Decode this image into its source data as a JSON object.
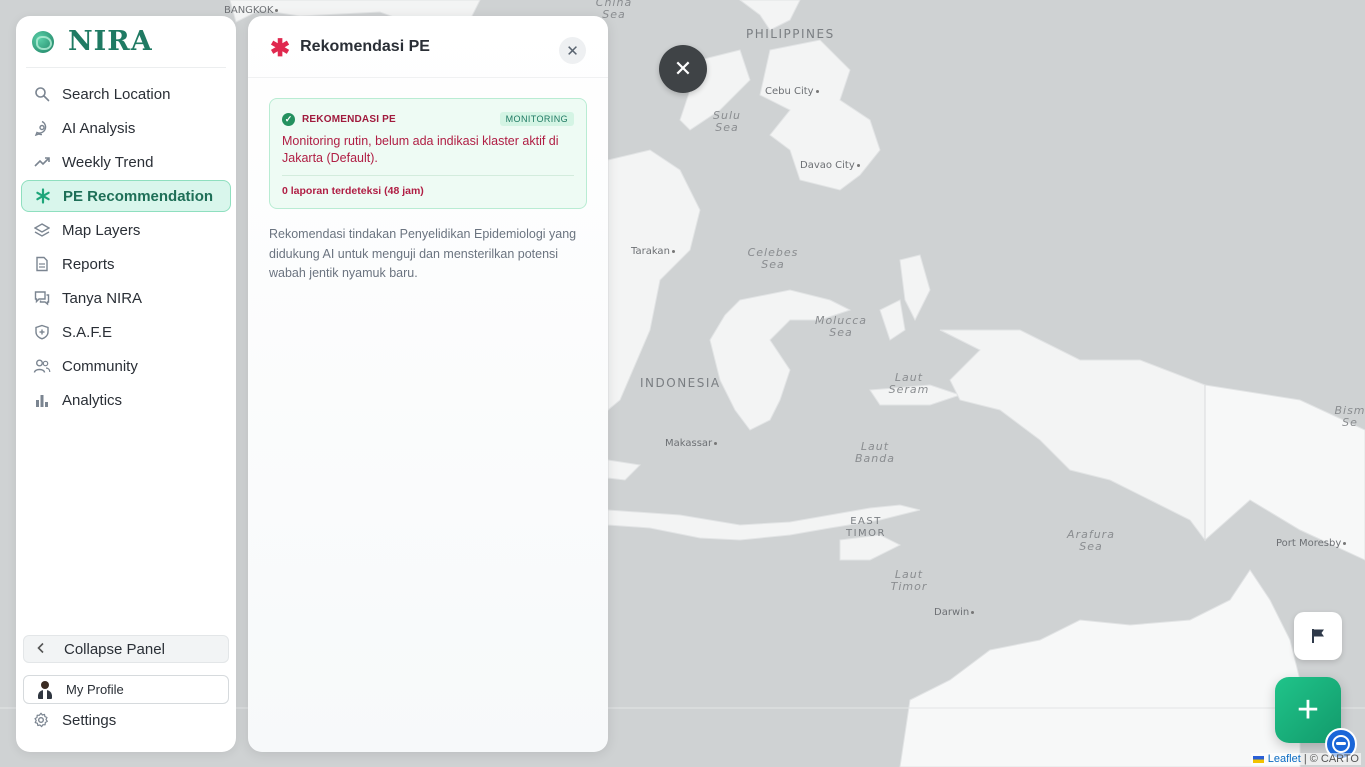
{
  "app": {
    "logo_text": "NIRA"
  },
  "sidebar": {
    "items": [
      {
        "label": "Search Location",
        "icon": "search-icon",
        "active": false
      },
      {
        "label": "AI Analysis",
        "icon": "ai-analysis-icon",
        "active": false
      },
      {
        "label": "Weekly Trend",
        "icon": "trend-icon",
        "active": false
      },
      {
        "label": "PE Recommendation",
        "icon": "asterisk-icon",
        "active": true
      },
      {
        "label": "Map Layers",
        "icon": "layers-icon",
        "active": false
      },
      {
        "label": "Reports",
        "icon": "report-icon",
        "active": false
      },
      {
        "label": "Tanya NIRA",
        "icon": "chat-icon",
        "active": false
      },
      {
        "label": "S.A.F.E",
        "icon": "shield-icon",
        "active": false
      },
      {
        "label": "Community",
        "icon": "community-icon",
        "active": false
      },
      {
        "label": "Analytics",
        "icon": "bar-chart-icon",
        "active": false
      }
    ],
    "collapse_label": "Collapse Panel",
    "profile_label": "My Profile",
    "settings_label": "Settings"
  },
  "panel": {
    "title": "Rekomendasi PE",
    "card": {
      "label": "REKOMENDASI PE",
      "badge": "MONITORING",
      "message": "Monitoring rutin, belum ada indikasi klaster aktif di Jakarta (Default).",
      "count": "0 laporan terdeteksi (48 jam)"
    },
    "description": "Rekomendasi tindakan Penyelidikan Epidemiologi yang didukung AI untuk menguji dan mensterilkan potensi wabah jentik nyamuk baru."
  },
  "map": {
    "labels": {
      "philippines": "PHILIPPINES",
      "indonesia": "INDONESIA",
      "east_timor": "EAST TIMOR",
      "sulu_sea": "Sulu Sea",
      "celebes_sea": "Celebes Sea",
      "molucca_sea": "Molucca Sea",
      "seram_sea": "Laut Seram",
      "banda_sea": "Laut Banda",
      "timor_sea": "Laut Timor",
      "arafura_sea": "Arafura Sea",
      "china_sea": "China Sea",
      "bismarck": "Bism Se"
    },
    "cities": {
      "bangkok": "BANGKOK",
      "cebu": "Cebu City",
      "davao": "Davao City",
      "tarakan": "Tarakan",
      "makassar": "Makassar",
      "darwin": "Darwin",
      "port_moresby": "Port Moresby"
    }
  },
  "attribution": {
    "leaflet": "Leaflet",
    "carto": "| © CARTO"
  },
  "colors": {
    "accent": "#1ea67a",
    "danger": "#e0294f",
    "sea": "#cfd2d3",
    "land": "#f3f4f4"
  }
}
